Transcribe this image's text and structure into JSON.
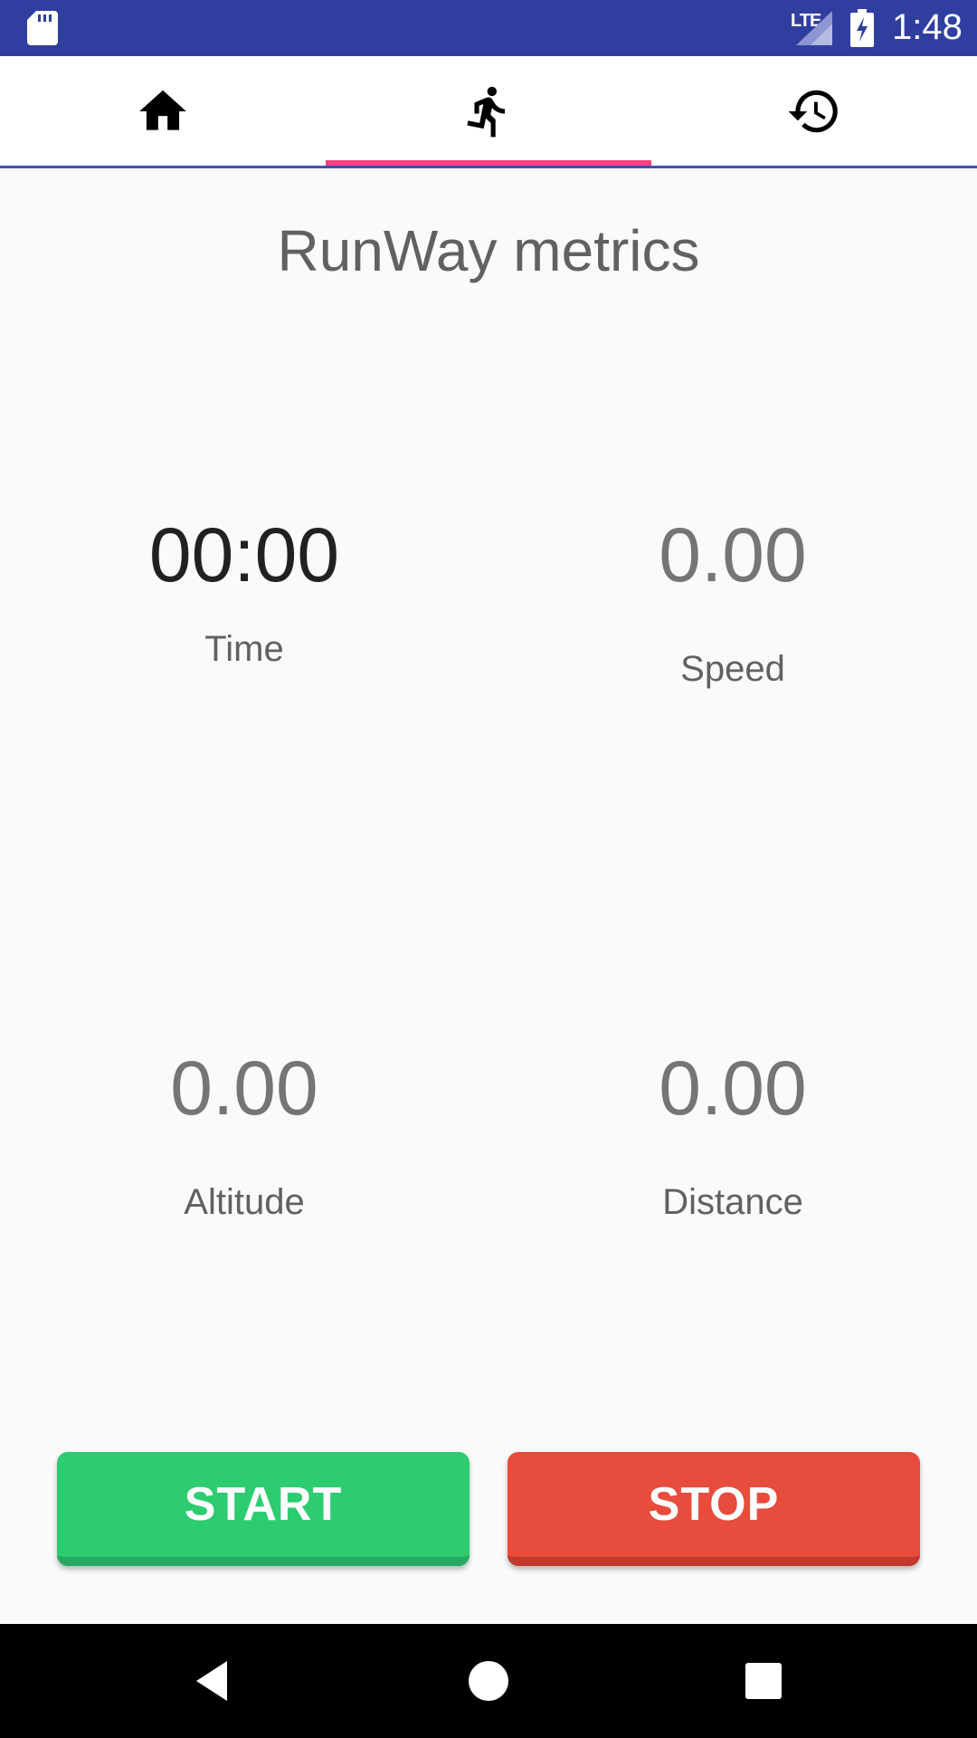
{
  "status_bar": {
    "network_label": "LTE",
    "time": "1:48",
    "icons": [
      "sd-card-icon",
      "signal-icon",
      "battery-charging-icon"
    ]
  },
  "tabs": [
    {
      "icon": "home-icon",
      "selected": false
    },
    {
      "icon": "run-icon",
      "selected": true
    },
    {
      "icon": "history-icon",
      "selected": false
    }
  ],
  "colors": {
    "status_bar": "#303f9f",
    "tab_indicator": "#ff4081",
    "tab_bar_border": "#3f51b5",
    "start_button": "#2ecc71",
    "stop_button": "#e74c3c"
  },
  "main": {
    "title": "RunWay metrics",
    "metrics": {
      "time": {
        "value": "00:00",
        "label": "Time"
      },
      "speed": {
        "value": "0.00",
        "label": "Speed"
      },
      "altitude": {
        "value": "0.00",
        "label": "Altitude"
      },
      "distance": {
        "value": "0.00",
        "label": "Distance"
      }
    }
  },
  "buttons": {
    "start_label": "START",
    "stop_label": "STOP"
  },
  "nav_bar": {
    "icons": [
      "back-icon",
      "home-circle-icon",
      "recents-icon"
    ]
  }
}
